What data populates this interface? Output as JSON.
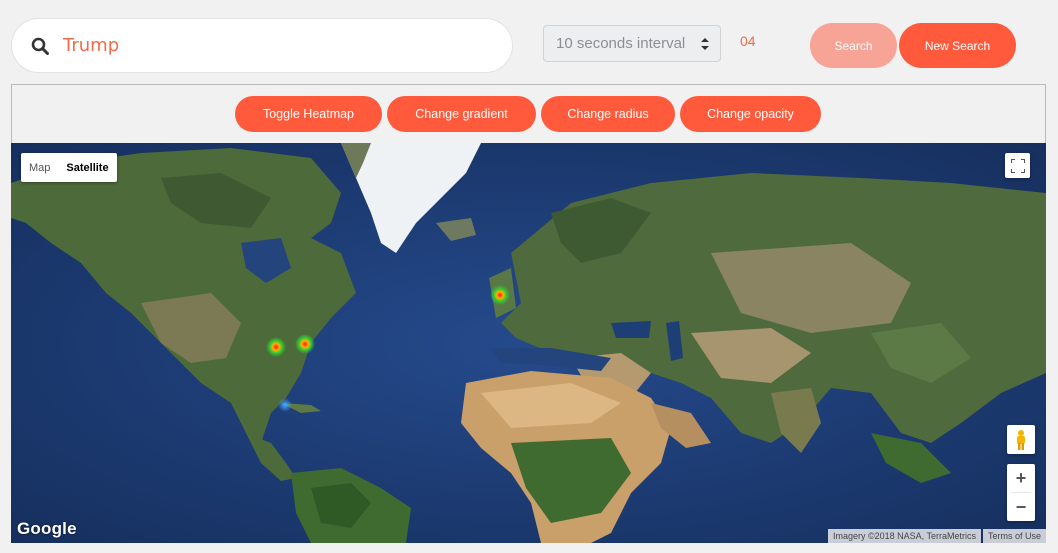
{
  "search": {
    "value": "Trump",
    "icon": "search-icon"
  },
  "interval": {
    "selected": "10 seconds interval"
  },
  "counter": "04",
  "buttons": {
    "search": "Search",
    "new_search": "New Search"
  },
  "toolbar": {
    "toggle_heatmap": "Toggle Heatmap",
    "change_gradient": "Change gradient",
    "change_radius": "Change radius",
    "change_opacity": "Change opacity"
  },
  "map": {
    "type_map": "Map",
    "type_satellite": "Satellite",
    "active_type": "Satellite",
    "zoom_in": "+",
    "zoom_out": "−",
    "logo": "Google",
    "attribution": "Imagery ©2018 NASA, TerraMetrics",
    "terms": "Terms of Use"
  },
  "colors": {
    "accent": "#ff5a3c",
    "accent_light": "#f7a396",
    "text_accent": "#f26a4b"
  }
}
